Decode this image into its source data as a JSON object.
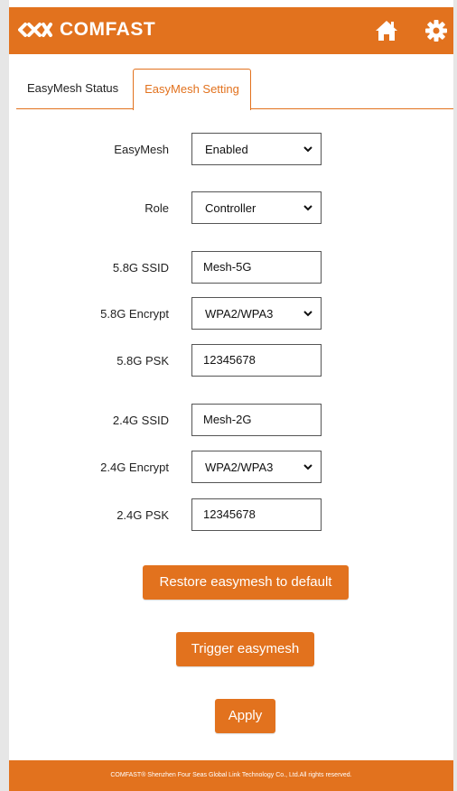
{
  "header": {
    "brand": "COMFAST",
    "icons": [
      "comfast-logo-icon",
      "home-icon",
      "gear-icon"
    ]
  },
  "tabs": [
    {
      "label": "EasyMesh Status",
      "active": false
    },
    {
      "label": "EasyMesh Setting",
      "active": true
    }
  ],
  "form": {
    "easymesh": {
      "label": "EasyMesh",
      "value": "Enabled"
    },
    "role": {
      "label": "Role",
      "value": "Controller"
    },
    "ssid_5g": {
      "label": "5.8G SSID",
      "value": "Mesh-5G"
    },
    "encrypt_5g": {
      "label": "5.8G Encrypt",
      "value": "WPA2/WPA3"
    },
    "psk_5g": {
      "label": "5.8G PSK",
      "value": "12345678"
    },
    "ssid_24g": {
      "label": "2.4G SSID",
      "value": "Mesh-2G"
    },
    "encrypt_24g": {
      "label": "2.4G Encrypt",
      "value": "WPA2/WPA3"
    },
    "psk_24g": {
      "label": "2.4G PSK",
      "value": "12345678"
    }
  },
  "buttons": {
    "restore": "Restore easymesh to default",
    "trigger": "Trigger easymesh",
    "apply": "Apply"
  },
  "footer": {
    "text": "COMFAST® Shenzhen Four Seas Global Link Technology Co., Ltd.All rights reserved."
  },
  "colors": {
    "accent": "#e2721e",
    "text": "#222222",
    "background": "#ffffff"
  }
}
